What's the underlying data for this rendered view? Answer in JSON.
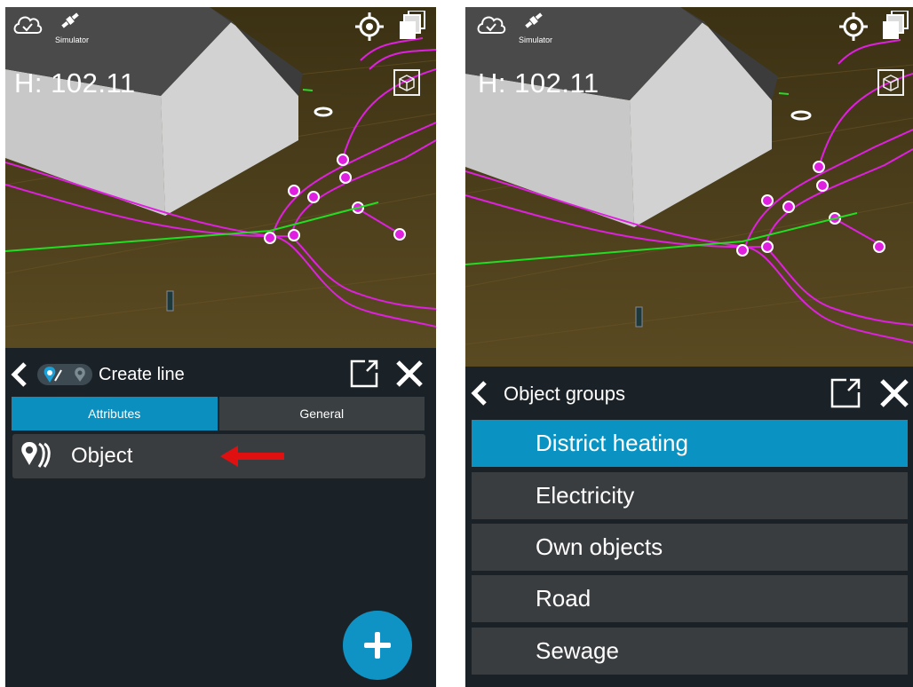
{
  "left": {
    "hud": {
      "height_label": "H: 102.11",
      "simulator_label": "Simulator"
    },
    "panel": {
      "title": "Create line",
      "tabs": [
        {
          "label": "Attributes",
          "active": true
        },
        {
          "label": "General",
          "active": false
        }
      ],
      "rows": [
        {
          "label": "Object",
          "icon": "object-pins-icon"
        }
      ],
      "fab_icon": "plus-icon"
    }
  },
  "right": {
    "hud": {
      "height_label": "H: 102.11",
      "simulator_label": "Simulator"
    },
    "panel": {
      "title": "Object groups",
      "groups": [
        {
          "label": "District heating",
          "selected": true
        },
        {
          "label": "Electricity",
          "selected": false
        },
        {
          "label": "Own objects",
          "selected": false
        },
        {
          "label": "Road",
          "selected": false
        },
        {
          "label": "Sewage",
          "selected": false
        }
      ]
    }
  },
  "colors": {
    "accent": "#0b8fbf",
    "pipe": "#e020e0",
    "line": "#22dd22",
    "arrow": "#e01010"
  }
}
